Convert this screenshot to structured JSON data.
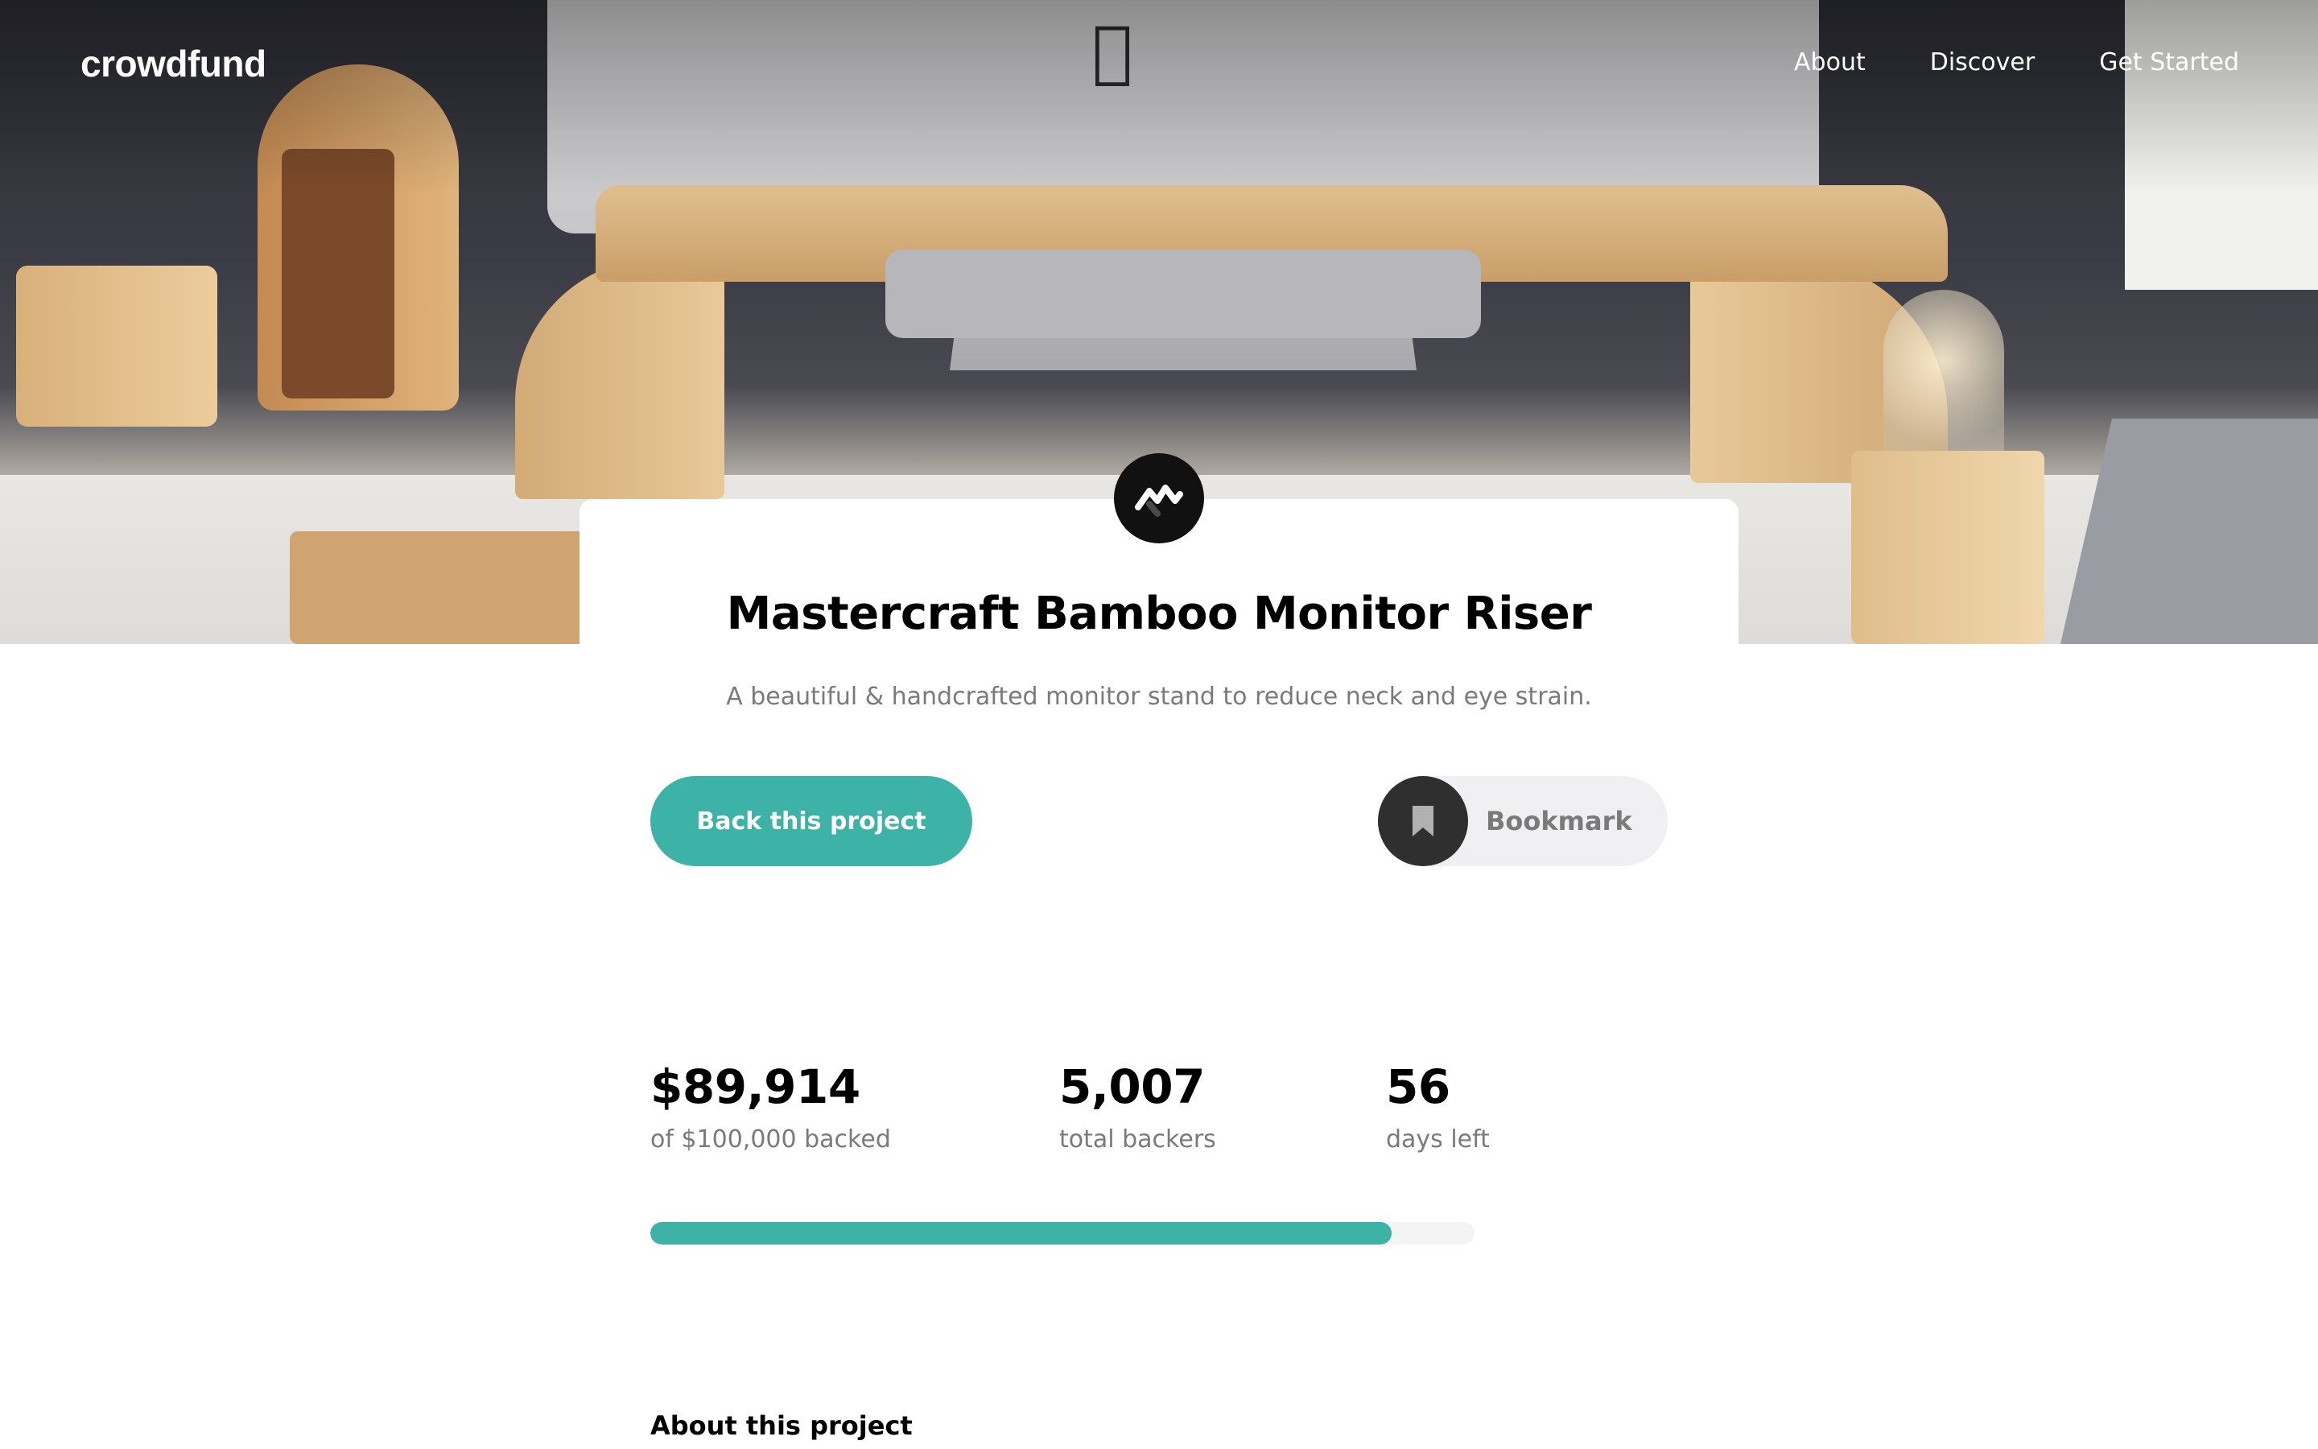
{
  "nav": {
    "logo": "crowdfund",
    "links": [
      "About",
      "Discover",
      "Get Started"
    ]
  },
  "hero": {
    "image_description": "desk with monitor on bamboo riser"
  },
  "project": {
    "badge_icon": "mastercraft-logo-icon",
    "title": "Mastercraft Bamboo Monitor Riser",
    "subtitle": "A beautiful & handcrafted monitor stand to reduce neck and eye strain.",
    "back_label": "Back this project",
    "bookmark_label": "Bookmark"
  },
  "stats": {
    "backed_amount": "$89,914",
    "backed_label": "of $100,000 backed",
    "backers_count": "5,007",
    "backers_label": "total backers",
    "days_count": "56",
    "days_label": "days left",
    "progress_fraction": 0.89914
  },
  "about": {
    "heading": "About this project"
  },
  "colors": {
    "accent": "#3cb3a6",
    "dark": "#2f2f2f",
    "muted_text": "#7a7a7a"
  }
}
